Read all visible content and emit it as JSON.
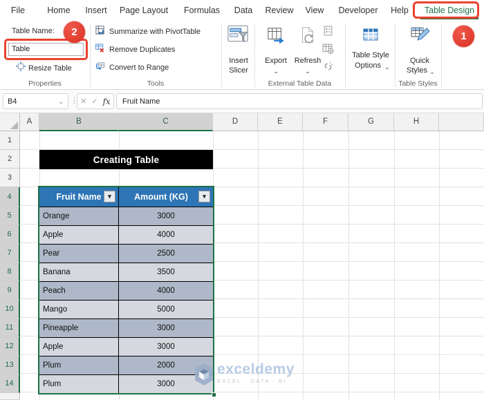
{
  "tabs": {
    "items": [
      "File",
      "Home",
      "Insert",
      "Page Layout",
      "Formulas",
      "Data",
      "Review",
      "View",
      "Developer",
      "Help",
      "Table Design"
    ],
    "active": "Table Design"
  },
  "ribbon": {
    "properties_group": {
      "title": "Properties",
      "table_name_label": "Table Name:",
      "table_name_value": "Table",
      "resize_table_label": "Resize Table"
    },
    "tools_group": {
      "title": "Tools",
      "items": [
        "Summarize with PivotTable",
        "Remove Duplicates",
        "Convert to Range"
      ]
    },
    "insert_slicer": {
      "line1": "Insert",
      "line2": "Slicer"
    },
    "external_group": {
      "title": "External Table Data",
      "export_label": "Export",
      "refresh_label": "Refresh"
    },
    "table_styles_group": {
      "title": "Table Styles",
      "tso_line1": "Table Style",
      "tso_line2": "Options",
      "qs_line1": "Quick",
      "qs_line2": "Styles"
    }
  },
  "formula_bar": {
    "name_box": "B4",
    "formula": "Fruit Name"
  },
  "sheet": {
    "col_headers": [
      "A",
      "B",
      "C",
      "D",
      "E",
      "F",
      "G",
      "H"
    ],
    "row_headers": [
      "1",
      "2",
      "3",
      "4",
      "5",
      "6",
      "7",
      "8",
      "9",
      "10",
      "11",
      "12",
      "13",
      "14"
    ],
    "banner": "Creating Table"
  },
  "table": {
    "headers": [
      "Fruit Name",
      "Amount (KG)"
    ],
    "rows": [
      {
        "fruit": "Orange",
        "amount": "3000"
      },
      {
        "fruit": "Apple",
        "amount": "4000"
      },
      {
        "fruit": "Pear",
        "amount": "2500"
      },
      {
        "fruit": "Banana",
        "amount": "3500"
      },
      {
        "fruit": "Peach",
        "amount": "4000"
      },
      {
        "fruit": "Mango",
        "amount": "5000"
      },
      {
        "fruit": "Pineapple",
        "amount": "3000"
      },
      {
        "fruit": "Apple",
        "amount": "3000"
      },
      {
        "fruit": "Plum",
        "amount": "2000"
      },
      {
        "fruit": "Plum",
        "amount": "3000"
      }
    ]
  },
  "watermark": {
    "brand": "exceldemy",
    "tagline": "EXCEL - DATA - BI"
  },
  "annotations": {
    "step_1": "1",
    "step_2": "2"
  },
  "icons": {
    "chevron_down": "⌄",
    "name_box_chevron": "⌄",
    "dots": "⋮",
    "cancel": "✕",
    "check": "✓",
    "fx": "fx",
    "filter_arrow": "▾"
  },
  "colors": {
    "accent_green": "#1E7145",
    "active_tab_green": "#217346",
    "annotation_red": "#E8432F",
    "table_header_blue": "#2E75B6",
    "band_dark": "#AEB8C8",
    "band_light": "#D5D8DE"
  }
}
